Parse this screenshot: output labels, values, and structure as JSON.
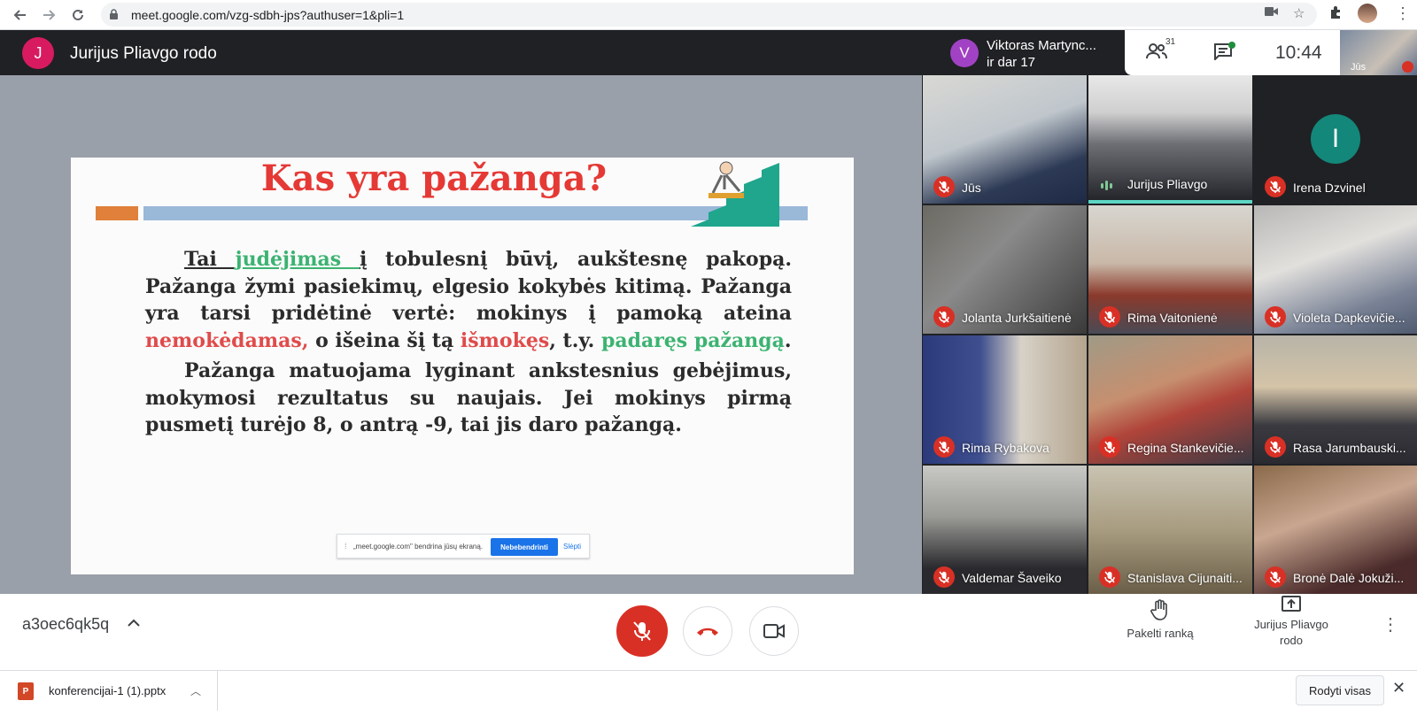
{
  "browser": {
    "url": "meet.google.com/vzg-sdbh-jps?authuser=1&pli=1",
    "icons": [
      "back-icon",
      "forward-icon",
      "reload-icon",
      "lock-icon",
      "camera-blocked-icon",
      "star-icon",
      "extensions-icon",
      "profile-avatar"
    ]
  },
  "meet": {
    "presenter_initial": "J",
    "presenter_title": "Jurijus Pliavgo rodo",
    "active_speaker": {
      "initial": "V",
      "name": "Viktoras Martync...",
      "subtitle": "ir dar 17"
    },
    "people_count": "31",
    "time": "10:44",
    "self_label": "Jūs",
    "accent_colors": {
      "mute": "#d93025",
      "speaking": "#5bd6c4",
      "avatar_irena": "#12877a"
    }
  },
  "slide": {
    "title": "Kas yra pažanga?",
    "p1": {
      "a": "Tai ",
      "b": "judėjimas ",
      "c": "į",
      "d": " tobulesnį būvį, aukštesnę pakopą. Pažanga žymi pasiekimų, elgesio kokybės kitimą. Pažanga yra tarsi pridėtinė vertė: mokinys į pamoką ateina ",
      "e": "nemokėdamas,",
      "f": " o išeina šį tą ",
      "g": "išmokęs",
      "h": ", t.y. ",
      "i": "padaręs pažangą",
      "j": "."
    },
    "p2": "Pažanga matuojama lyginant ankstesnius gebėjimus, mokymosi rezultatus su naujais. Jei mokinys pirmą pusmetį turėjo 8, o antrą -9, tai jis daro pažangą.",
    "share_bar": {
      "text": "„meet.google.com\" bendrina jūsų ekraną.",
      "stop_label": "Nebebendrinti",
      "hide_label": "Slėpti"
    }
  },
  "participants": [
    {
      "name": "Jūs",
      "muted": true
    },
    {
      "name": "Jurijus Pliavgo",
      "muted": false,
      "speaking": true
    },
    {
      "name": "Irena Dzvinel",
      "muted": true,
      "initial": "I"
    },
    {
      "name": "Jolanta Jurkšaitienė",
      "muted": true
    },
    {
      "name": "Rima Vaitonienė",
      "muted": true
    },
    {
      "name": "Violeta Dapkevičie...",
      "muted": true
    },
    {
      "name": "Rima Rybakova",
      "muted": true
    },
    {
      "name": "Regina Stankevičie...",
      "muted": true
    },
    {
      "name": "Rasa Jarumbauski...",
      "muted": true
    },
    {
      "name": "Valdemar Šaveiko",
      "muted": true
    },
    {
      "name": "Stanislava Cijunaiti...",
      "muted": true
    },
    {
      "name": "Bronė Dalė Jokuži...",
      "muted": true
    }
  ],
  "controls": {
    "meeting_code": "a3oec6qk5q",
    "raise_hand_label": "Pakelti ranką",
    "presenting_label_line1": "Jurijus Pliavgo",
    "presenting_label_line2": "rodo"
  },
  "downloads": {
    "file_name": "konferencijai-1 (1).pptx",
    "file_badge": "P",
    "show_all_label": "Rodyti visas",
    "close_glyph": "✕"
  }
}
